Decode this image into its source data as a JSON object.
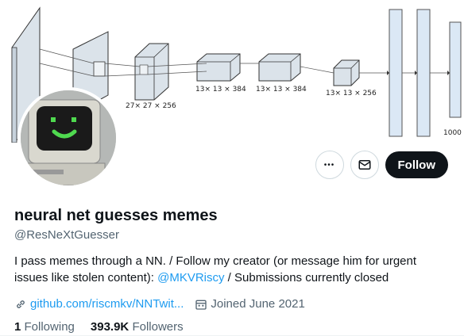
{
  "banner": {
    "labels": {
      "dim_27": "27× 27 × 256",
      "dim_13_a": "13× 13 × 384",
      "dim_13_b": "13× 13 × 384",
      "dim_13_c": "13× 13 × 256",
      "output": "1000"
    }
  },
  "actions": {
    "more_glyph": "•••",
    "follow_label": "Follow"
  },
  "profile": {
    "name": "neural net guesses memes",
    "handle": "@ResNeXtGuesser",
    "bio_part1": "I pass memes through a NN. / Follow my creator (or message him for urgent issues like stolen content): ",
    "bio_mention": "@MKVRiscy",
    "bio_part2": " / Submissions currently closed",
    "website": "github.com/riscmkv/NNTwit...",
    "joined": "Joined June 2021",
    "following_count": "1",
    "following_label": "Following",
    "followers_count": "393.9K",
    "followers_label": "Followers"
  },
  "colors": {
    "accent": "#1d9bf0",
    "text": "#0f1419",
    "muted": "#536471",
    "screen_face": "#4fd94f"
  }
}
